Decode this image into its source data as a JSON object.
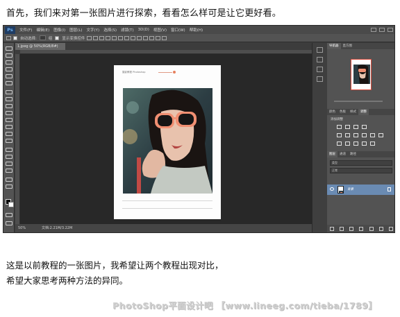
{
  "article": {
    "intro": "首先，我们来对第一张图片进行探索，看看怎么样可是让它更好看。",
    "outro_line1": "这是以前教程的一张图片，我希望让两个教程出现对比，",
    "outro_line2": "希望大家思考两种方法的异同。",
    "watermark": "PhotoShop平面设计吧 【www.lineeg.com/tieba/1789】"
  },
  "photoshop": {
    "logo": "Ps",
    "menu": [
      "文件(F)",
      "编辑(E)",
      "图像(I)",
      "图层(L)",
      "文字(Y)",
      "选择(S)",
      "滤镜(T)",
      "3D(D)",
      "视图(V)",
      "窗口(W)",
      "帮助(H)"
    ],
    "options": {
      "auto_select_label": "自动选择:",
      "auto_select_value": "组",
      "transform_label": "显示变换控件"
    },
    "doc_tab": "1.jpeg @ 50%(RGB/8#)",
    "status": {
      "zoom": "50%",
      "doc_info": "文档:2.21M/3.22M"
    },
    "doc_page": {
      "brand_text": "摄影教程  Photoshop"
    },
    "panels": {
      "nav_tabs": [
        "导航器",
        "直方图"
      ],
      "adjust_tabs": [
        "颜色",
        "色板",
        "样式",
        "调整"
      ],
      "adjust_title": "添加调整",
      "layers_tabs": [
        "图层",
        "通道",
        "路径"
      ],
      "filter_kind": "类型",
      "blend_mode": "正常",
      "layer_name": "背景"
    }
  }
}
